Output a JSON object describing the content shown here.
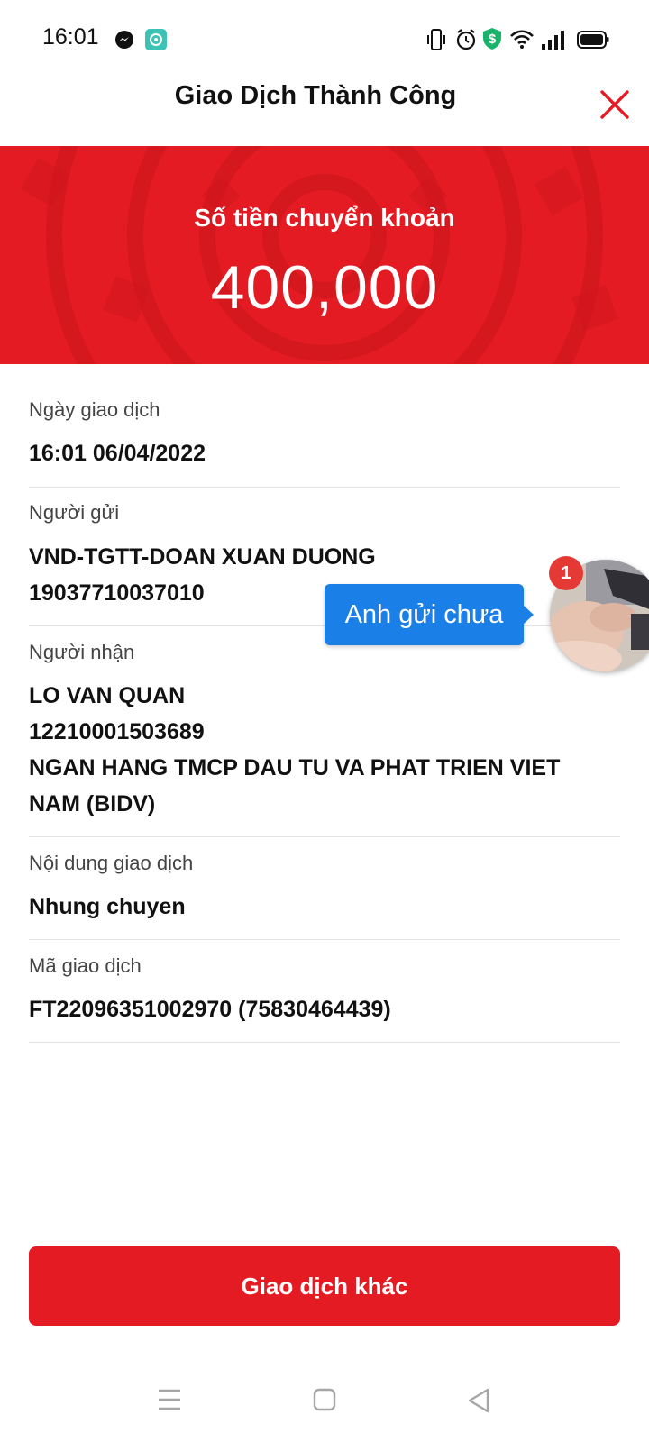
{
  "status_bar": {
    "time": "16:01",
    "icons": [
      "messenger-icon",
      "chat-app-icon",
      "vibrate-icon",
      "alarm-icon",
      "shield-dollar-icon",
      "wifi-icon",
      "signal-icon",
      "battery-icon"
    ]
  },
  "header": {
    "title": "Giao Dịch Thành Công",
    "close_icon": "close-icon"
  },
  "banner": {
    "label": "Số tiền chuyển khoản",
    "amount": "400,000"
  },
  "details": [
    {
      "label": "Ngày giao dịch",
      "value_lines": [
        "16:01 06/04/2022"
      ]
    },
    {
      "label": "Người gửi",
      "value_lines": [
        "VND-TGTT-DOAN XUAN DUONG",
        "19037710037010"
      ]
    },
    {
      "label": "Người nhận",
      "value_lines": [
        "LO VAN QUAN",
        "12210001503689",
        "NGAN HANG TMCP DAU TU VA PHAT TRIEN VIET NAM (BIDV)"
      ]
    },
    {
      "label": "Nội dung giao dịch",
      "value_lines": [
        "Nhung chuyen"
      ]
    },
    {
      "label": "Mã giao dịch",
      "value_lines": [
        "FT22096351002970 (75830464439)"
      ]
    }
  ],
  "chat_overlay": {
    "message": "Anh gửi chưa",
    "badge_count": "1"
  },
  "actions": {
    "other_transaction": "Giao dịch khác"
  },
  "nav_bar": {
    "icons": [
      "menu-icon",
      "home-icon",
      "back-icon"
    ]
  },
  "colors": {
    "brand_red": "#e41b23",
    "chat_blue": "#1a7fe6",
    "badge_red": "#e53935"
  }
}
